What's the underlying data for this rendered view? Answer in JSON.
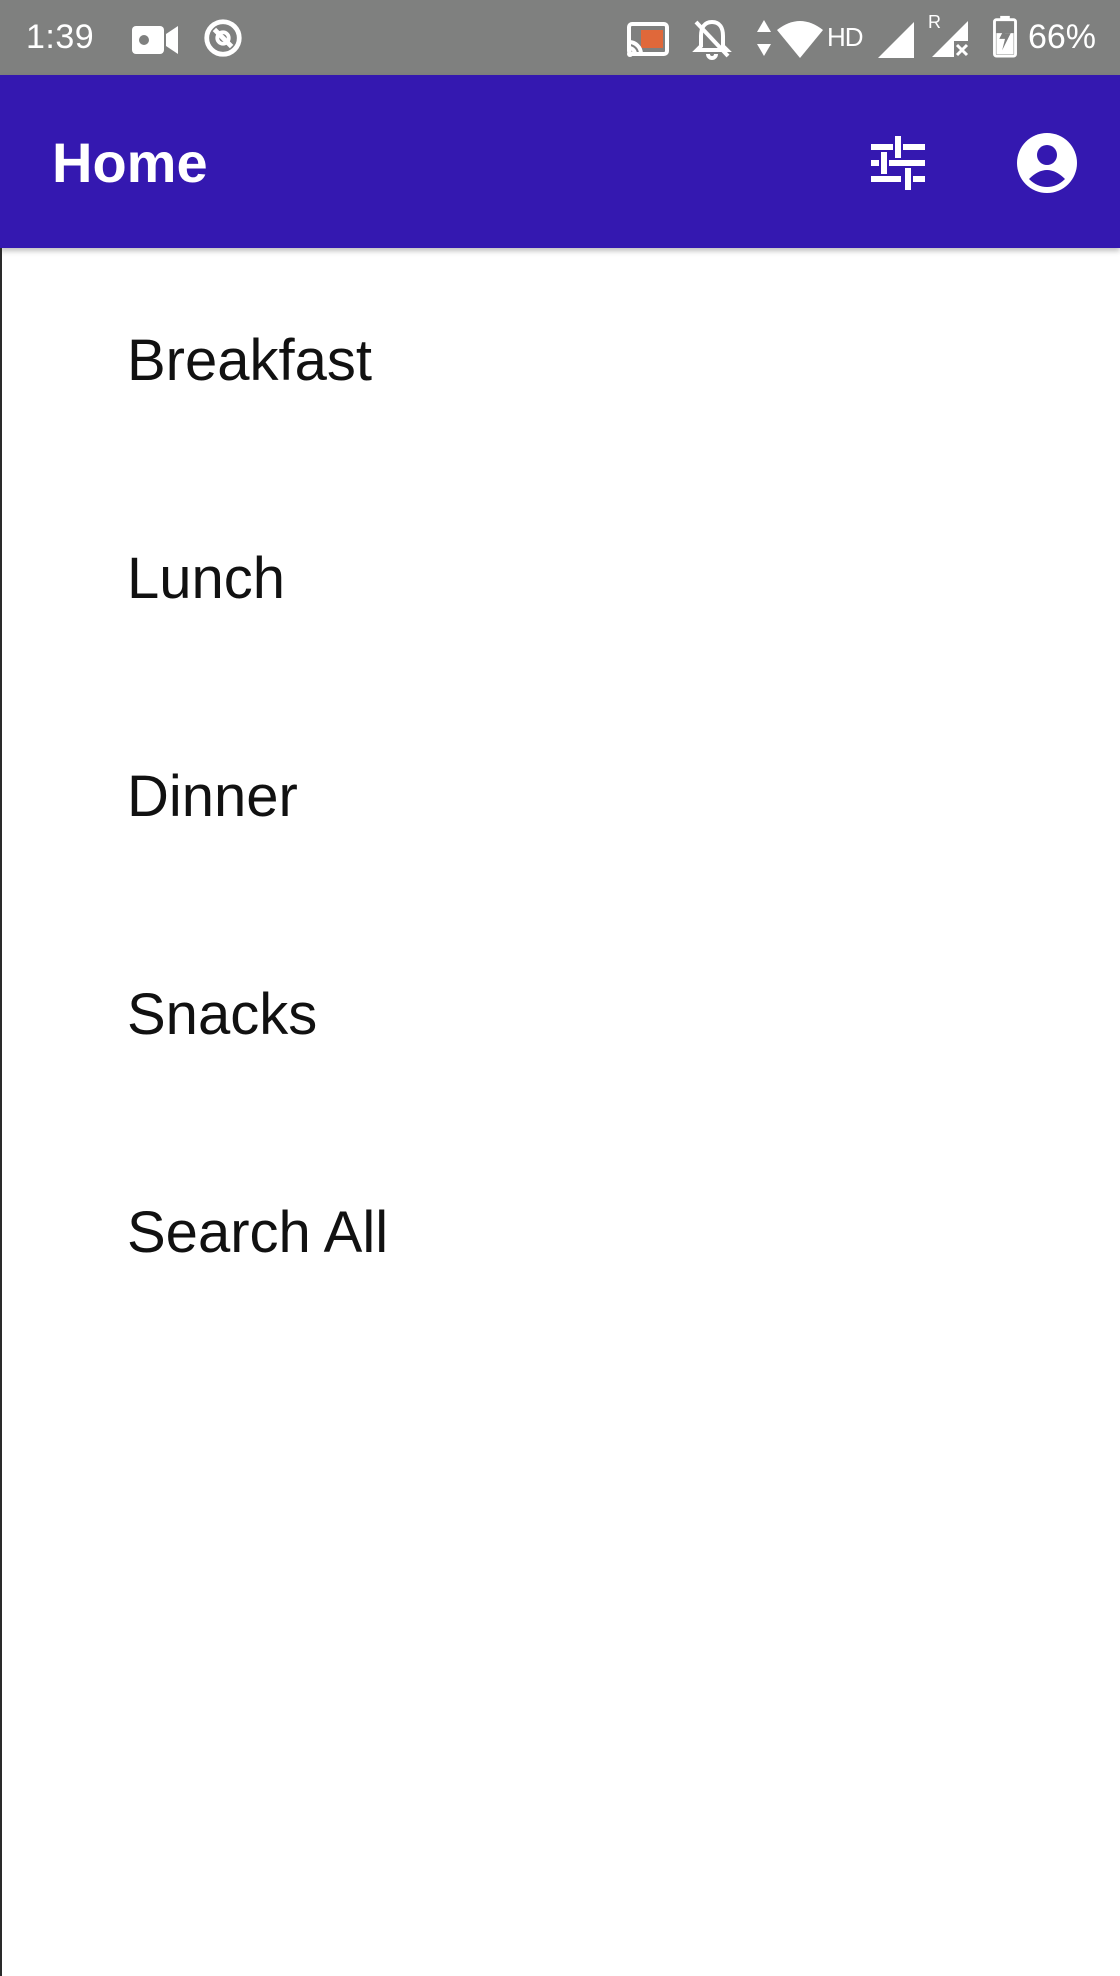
{
  "status_bar": {
    "time": "1:39",
    "network_label": "HD",
    "roaming_label": "R",
    "battery": "66%",
    "icons": [
      "video-camera-icon",
      "sync-off-icon",
      "cast-icon",
      "notifications-off-icon",
      "data-arrows-icon",
      "wifi-icon",
      "signal-icon",
      "signal-roaming-icon",
      "battery-charging-icon"
    ],
    "background_color": "#7f807f"
  },
  "app_bar": {
    "title": "Home",
    "background_color": "#3418b0",
    "actions": [
      "filter-sliders-icon",
      "account-circle-icon"
    ]
  },
  "menu": {
    "items": [
      {
        "label": "Breakfast"
      },
      {
        "label": "Lunch"
      },
      {
        "label": "Dinner"
      },
      {
        "label": "Snacks"
      },
      {
        "label": "Search All"
      }
    ]
  }
}
